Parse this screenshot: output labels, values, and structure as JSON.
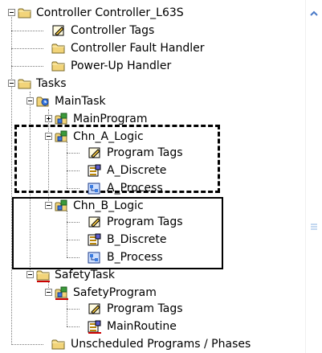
{
  "tree": {
    "controller": "Controller Controller_L63S",
    "controller_tags": "Controller Tags",
    "fault_handler": "Controller Fault Handler",
    "powerup_handler": "Power-Up Handler",
    "tasks": "Tasks",
    "main_task": "MainTask",
    "main_program": "MainProgram",
    "chn_a_logic": "Chn_A_Logic",
    "chn_a_program_tags": "Program Tags",
    "a_discrete": "A_Discrete",
    "a_process": "A_Process",
    "chn_b_logic": "Chn_B_Logic",
    "chn_b_program_tags": "Program Tags",
    "b_discrete": "B_Discrete",
    "b_process": "B_Process",
    "safety_task": "SafetyTask",
    "safety_program": "SafetyProgram",
    "safety_program_tags": "Program Tags",
    "main_routine": "MainRoutine",
    "unscheduled": "Unscheduled Programs / Phases"
  },
  "icons": {
    "folder": "folder-icon",
    "tags": "tags-icon",
    "task": "task-icon",
    "program": "program-icon",
    "routine": "routine-icon"
  },
  "colors": {
    "folder": "#f2d479",
    "safety_red": "#cc0000"
  }
}
